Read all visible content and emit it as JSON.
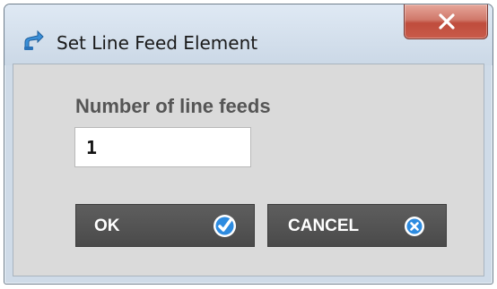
{
  "window": {
    "title": "Set Line Feed Element",
    "app_icon": "line-feed-app-icon",
    "close_icon": "close-icon"
  },
  "form": {
    "label": "Number of line feeds",
    "input_value": "1"
  },
  "buttons": {
    "ok_label": "OK",
    "ok_icon": "checkmark-icon",
    "cancel_label": "CANCEL",
    "cancel_icon": "x-icon"
  },
  "colors": {
    "button_bg": "#555555",
    "button_text": "#ffffff",
    "label_text": "#555555",
    "close_red": "#c95b4b",
    "ok_icon_blue": "#2d8be0"
  }
}
